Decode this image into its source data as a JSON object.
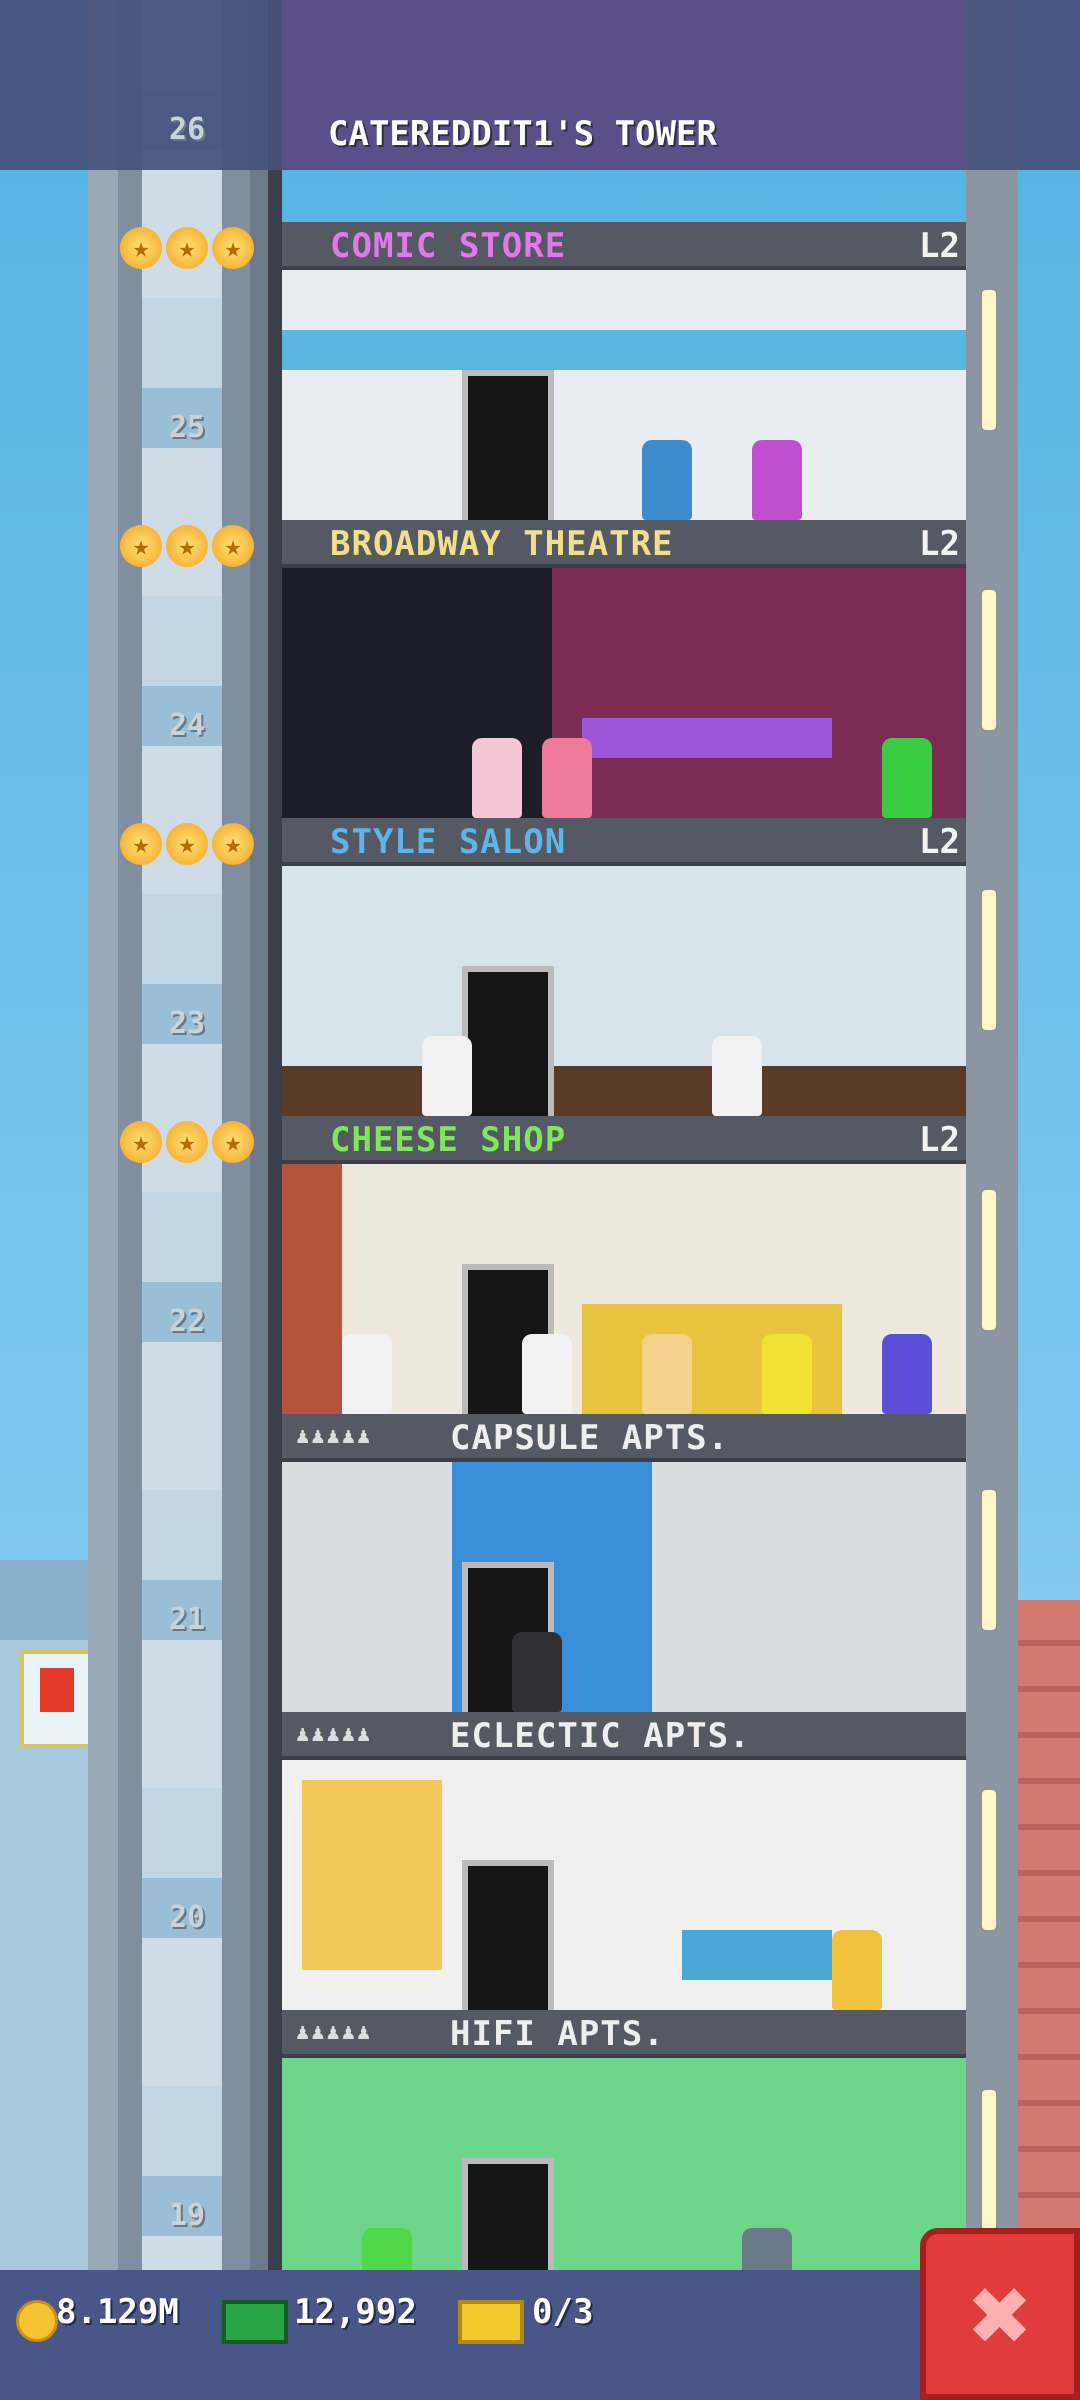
{
  "tower": {
    "title": "CATEREDDIT1'S TOWER",
    "top_floor_number": "26"
  },
  "floors": [
    {
      "number": "25",
      "name": "COMIC STORE",
      "level": "L2",
      "name_color": "#e07ae8",
      "stars": 3,
      "room_color": "#e9edf2"
    },
    {
      "number": "24",
      "name": "BROADWAY THEATRE",
      "level": "L2",
      "name_color": "#f0e08a",
      "stars": 3,
      "room_color": "#7a2c55"
    },
    {
      "number": "23",
      "name": "STYLE SALON",
      "level": "L2",
      "name_color": "#5fb5e8",
      "stars": 3,
      "room_color": "#d7e4ea"
    },
    {
      "number": "22",
      "name": "CHEESE SHOP",
      "level": "L2",
      "name_color": "#7ee85a",
      "stars": 3,
      "room_color": "#efe8df"
    },
    {
      "number": "21",
      "name": "CAPSULE APTS.",
      "name_color": "#eeeeee",
      "residential": true,
      "room_color": "#3a8fd8"
    },
    {
      "number": "20",
      "name": "ECLECTIC APTS.",
      "name_color": "#eeeeee",
      "residential": true,
      "room_color": "#f0f0f0"
    },
    {
      "number": "19",
      "name": "HIFI APTS.",
      "name_color": "#eeeeee",
      "residential": true,
      "room_color": "#6ed68a"
    }
  ],
  "resources": {
    "coins": "8.129M",
    "bux": "12,992",
    "tickets": "0/3"
  },
  "icons": {
    "coin": "coin-icon",
    "bux": "bux-icon",
    "ticket": "ticket-icon",
    "close": "close-icon",
    "star": "star-icon",
    "resident": "resident-icon"
  },
  "close_label": "✖"
}
